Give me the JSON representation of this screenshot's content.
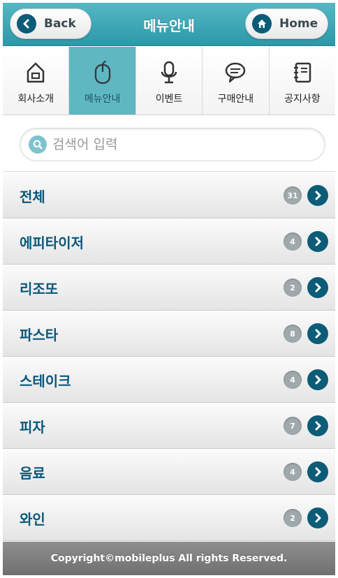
{
  "header": {
    "title": "메뉴안내",
    "back_label": "Back",
    "home_label": "Home",
    "back_icon": "chevron-left-icon",
    "home_icon": "home-icon",
    "color": "#2c98a8"
  },
  "nav": {
    "tabs": [
      {
        "label": "회사소개",
        "icon": "house-icon",
        "active": false
      },
      {
        "label": "메뉴안내",
        "icon": "mouse-icon",
        "active": true
      },
      {
        "label": "이벤트",
        "icon": "microphone-icon",
        "active": false
      },
      {
        "label": "구매안내",
        "icon": "chat-bubble-icon",
        "active": false
      },
      {
        "label": "공지사항",
        "icon": "notebook-icon",
        "active": false
      }
    ],
    "active_color": "#5fb7c2"
  },
  "search": {
    "placeholder": "검색어 입력",
    "value": ""
  },
  "categories": [
    {
      "label": "전체",
      "count": "31"
    },
    {
      "label": "에피타이저",
      "count": "4"
    },
    {
      "label": "리조또",
      "count": "2"
    },
    {
      "label": "파스타",
      "count": "8"
    },
    {
      "label": "스테이크",
      "count": "4"
    },
    {
      "label": "피자",
      "count": "7"
    },
    {
      "label": "음료",
      "count": "4"
    },
    {
      "label": "와인",
      "count": "2"
    }
  ],
  "accent_color": "#0c5c78",
  "footer": {
    "text": "Copyright©mobileplus All rights Reserved."
  }
}
